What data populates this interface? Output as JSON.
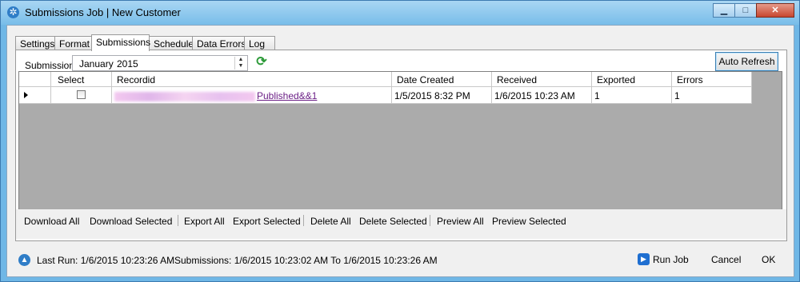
{
  "window": {
    "title": "Submissions Job | New Customer"
  },
  "tabs": [
    "Settings",
    "Format",
    "Submissions",
    "Schedule",
    "Data Errors",
    "Log"
  ],
  "filter": {
    "label": "Submissions",
    "month": "January",
    "year": "2015"
  },
  "auto_refresh": "Auto Refresh",
  "grid": {
    "columns": [
      "Select",
      "Recordid",
      "Date Created",
      "Received",
      "Exported",
      "Errors"
    ],
    "rows": [
      {
        "record_link": "Published&&1",
        "date_created": "1/5/2015 8:32 PM",
        "received": "1/6/2015 10:23 AM",
        "exported": "1",
        "errors": "1"
      }
    ]
  },
  "actions": [
    "Download All",
    "Download Selected",
    "Export All",
    "Export Selected",
    "Delete All",
    "Delete Selected",
    "Preview All",
    "Preview Selected"
  ],
  "status": {
    "last_run": "Last Run: 1/6/2015 10:23:26 AM",
    "submissions": "Submissions: 1/6/2015 10:23:02 AM To 1/6/2015 10:23:26 AM"
  },
  "buttons": {
    "run_job": "Run Job",
    "cancel": "Cancel",
    "ok": "OK"
  }
}
